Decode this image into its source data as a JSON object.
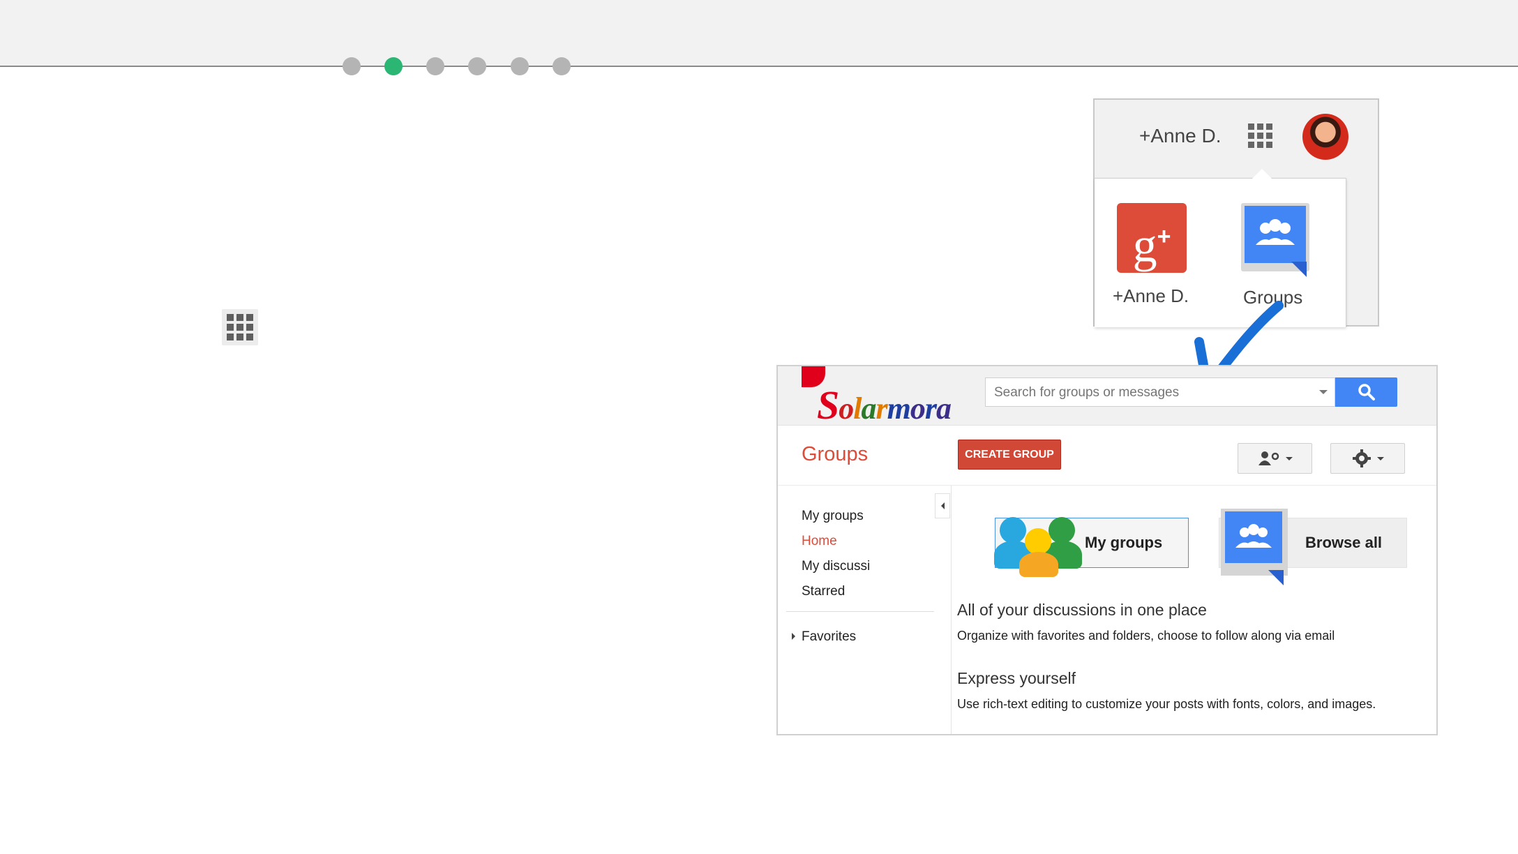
{
  "pager": {
    "dots": 6,
    "active_index": 1
  },
  "account_callout": {
    "account_name": "+Anne D.",
    "apps": [
      {
        "label": "+Anne D.",
        "icon": "google-plus-icon"
      },
      {
        "label": "Groups",
        "icon": "google-groups-icon"
      }
    ],
    "gplus_glyph": "g",
    "gplus_plus": "+"
  },
  "groups_app": {
    "logo_text": "Solarmora",
    "search": {
      "placeholder": "Search for groups or messages"
    },
    "title": "Groups",
    "create_button": "CREATE GROUP",
    "nav": {
      "items": [
        "My groups",
        "Home",
        "My discussi",
        "Starred"
      ],
      "active": "Home",
      "favorites": "Favorites"
    },
    "buttons": {
      "my_groups": "My groups",
      "browse_all": "Browse all"
    },
    "features": [
      {
        "title": "All of your discussions in one place",
        "text": "Organize with favorites and folders, choose to follow along via email"
      },
      {
        "title": "Express yourself",
        "text": "Use rich-text editing to customize your posts with fonts, colors, and images."
      }
    ]
  },
  "colors": {
    "pager_active": "#2bb673",
    "pager_inactive": "#b4b4b4",
    "groups_red": "#dd4b39",
    "google_blue": "#4285f4",
    "create_button": "#d14836"
  }
}
